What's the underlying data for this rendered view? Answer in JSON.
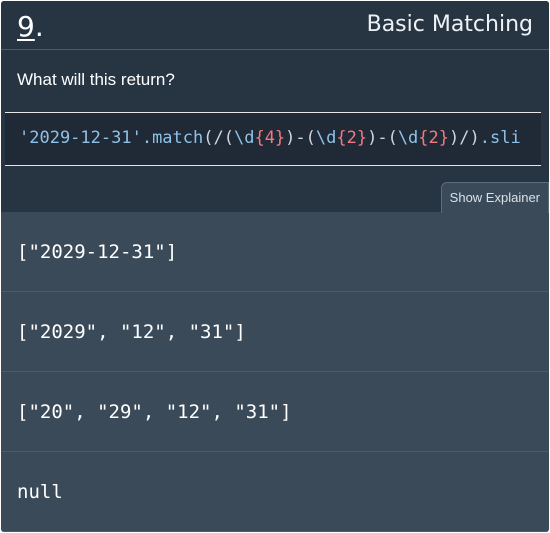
{
  "header": {
    "question_number": "9",
    "question_dot": ".",
    "title": "Basic Matching"
  },
  "question": {
    "prompt": "What will this return?",
    "code_tokens": [
      {
        "text": "'2029-12-31'",
        "kind": "str"
      },
      {
        "text": ".match",
        "kind": "fn"
      },
      {
        "text": "(/(",
        "kind": "punct"
      },
      {
        "text": "\\d",
        "kind": "esc"
      },
      {
        "text": "{4}",
        "kind": "num"
      },
      {
        "text": ")-(",
        "kind": "punct"
      },
      {
        "text": "\\d",
        "kind": "esc"
      },
      {
        "text": "{2}",
        "kind": "num"
      },
      {
        "text": ")-(",
        "kind": "punct"
      },
      {
        "text": "\\d",
        "kind": "esc"
      },
      {
        "text": "{2}",
        "kind": "num"
      },
      {
        "text": ")/)",
        "kind": "punct"
      },
      {
        "text": ".sli",
        "kind": "fn"
      }
    ]
  },
  "explainer_button": {
    "label": "Show Explainer"
  },
  "answers": [
    {
      "label": "[\"2029-12-31\"]"
    },
    {
      "label": "[\"2029\", \"12\", \"31\"]"
    },
    {
      "label": "[\"20\", \"29\", \"12\", \"31\"]"
    },
    {
      "label": "null"
    }
  ],
  "colors": {
    "background": "#3a4a59",
    "header_bg": "#273442",
    "code_bg": "#1f2a36",
    "code_string": "#8fc1e8",
    "code_number": "#f07a82"
  }
}
